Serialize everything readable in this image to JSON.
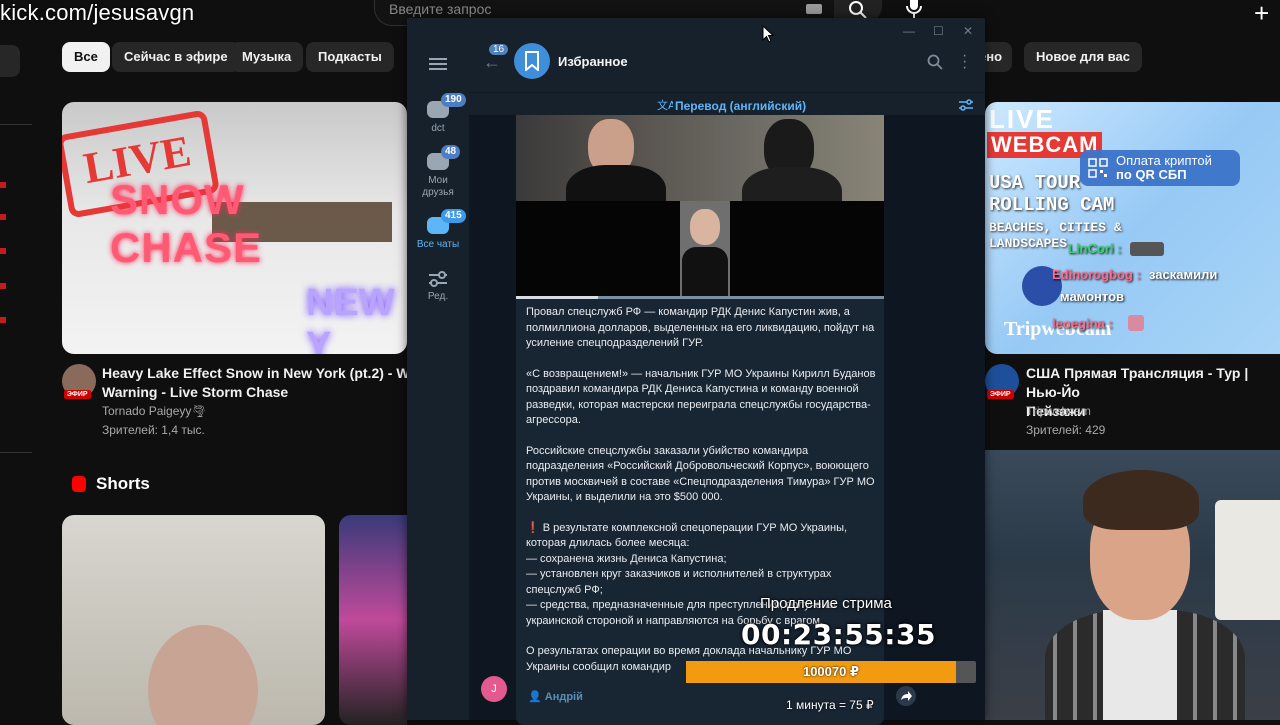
{
  "overlay": {
    "url": "kick.com/jesusavgn",
    "extension_label": "Продление стрима",
    "timer": "00:23:55:35",
    "donate_total": "100070 ₽",
    "rate": "1 минута = 75 ₽",
    "donate_progress": 0.93
  },
  "youtube": {
    "search_placeholder": "Введите запрос",
    "chips": [
      "Все",
      "Сейчас в эфире",
      "Музыка",
      "Подкасты",
      "ено",
      "Новое для вас"
    ],
    "video1": {
      "thumb_live": "LIVE",
      "thumb_snow": "SNOW CHASE",
      "thumb_new": "NEW Y",
      "title_line1": "Heavy Lake Effect Snow in New York (pt.2) - Winte",
      "title_line2": "Warning - Live Storm Chase",
      "channel": "Tornado Paigeyy🌪",
      "viewers": "Зрителей: 1,4 тыс.",
      "live_chip": "ЭФИР"
    },
    "shorts_label": "Shorts",
    "video2": {
      "thumb_live": "LIVE",
      "thumb_webcam": "WEBCAM",
      "thumb_lines": [
        "USA TOUR",
        "ROLLING CAM",
        "BEACHES, CITIES &",
        "LANDSCAPES"
      ],
      "thumb_brand": "Tripwebcam",
      "title_line1": "США Прямая Трансляция - Тур | Нью-Йо",
      "title_line2": "Пейзажи",
      "channel": "Tripwebcam",
      "viewers": "Зрителей: 429",
      "live_chip": "ЭФИР"
    },
    "stream_chat": {
      "qr_line1": "Оплата криптой",
      "qr_line2": "по QR СБП",
      "line1_user": "LinCori :",
      "line2_user": "Edinorogbog :",
      "line2_text": "заскамили",
      "line2_text2": "мамонтов",
      "line3_user": "leoegina :"
    }
  },
  "telegram": {
    "back_badge": "16",
    "folders": [
      {
        "badge": "190",
        "label": "dct"
      },
      {
        "badge": "48",
        "label": "Мои друзья"
      },
      {
        "badge": "415",
        "label": "Все чаты"
      },
      {
        "badge": "",
        "label": "Ред."
      }
    ],
    "chat_title": "Избранное",
    "translate_label": "Перевод (английский)",
    "message_paragraphs": [
      "Провал спецслужб РФ — командир РДК Денис Капустин жив, а полмиллиона долларов, выделенных на его ликвидацию, пойдут на усиление спецподразделений ГУР.",
      "«С возвращением!» — начальник ГУР МО Украины Кирилл Буданов поздравил командира РДК Дениса Капустина и команду военной разведки, которая мастерски переиграла спецслужбы государства-агрессора.",
      "Российские спецслужбы заказали убийство командира подразделения «Российский Добровольческий Корпус», воюющего против москвичей в составе «Спецподразделения Тимура» ГУР МО Украины, и выделили на это $500 000.",
      "❗ В результате комплексной спецоперации ГУР МО Украины, которая длилась более месяца:\n— сохранена жизнь Дениса Капустина;\n— установлен круг заказчиков и исполнителей в структурах спецслужб РФ;\n— средства, предназначенные для преступления, получены украинской стороной и направляются на борьбу с врагом.",
      "О результатах операции во время доклада начальнику ГУР МО Украины сообщил командир"
    ],
    "sender_initial": "J",
    "sender_name": "👤 Андрій"
  }
}
